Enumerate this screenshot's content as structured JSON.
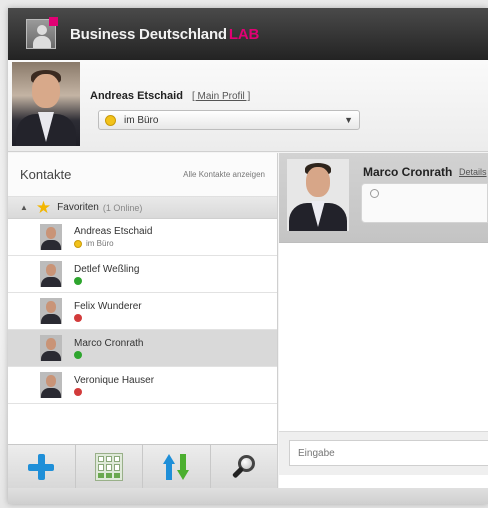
{
  "app": {
    "title": "Business Deutschland",
    "title_suffix": "LAB",
    "accent_color": "#e20074"
  },
  "user": {
    "name": "Andreas Etschaid",
    "main_profile_link": "[ Main Profil ]",
    "status_label": "im Büro",
    "status_icon": "smiley-icon"
  },
  "contacts": {
    "title": "Kontakte",
    "all_link": "Alle Kontakte anzeigen",
    "group": {
      "name": "Favoriten",
      "count": "(1 Online)"
    },
    "items": [
      {
        "name": "Andreas Etschaid",
        "status_text": "im Büro",
        "status": "away"
      },
      {
        "name": "Detlef Weßling",
        "status_text": "",
        "status": "online"
      },
      {
        "name": "Felix Wunderer",
        "status_text": "",
        "status": "offline"
      },
      {
        "name": "Marco Cronrath",
        "status_text": "",
        "status": "online",
        "selected": true
      },
      {
        "name": "Veronique Hauser",
        "status_text": "",
        "status": "offline"
      }
    ]
  },
  "toolbar": {
    "buttons": [
      "add-contact-icon",
      "dialpad-icon",
      "sync-icon",
      "search-icon"
    ]
  },
  "chat": {
    "contact_name": "Marco Cronrath",
    "details_link": "Details",
    "input_placeholder": "Eingabe"
  }
}
